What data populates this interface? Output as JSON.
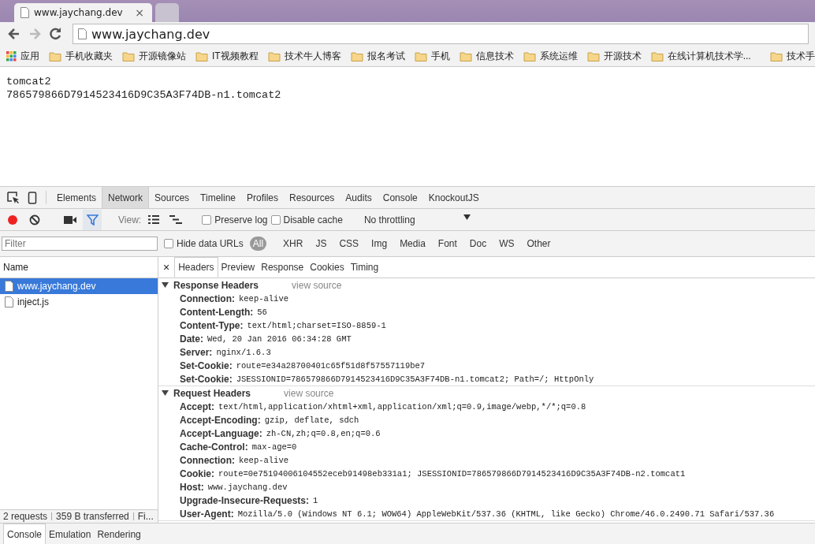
{
  "browser": {
    "tabs": [
      {
        "title": "www.jaychang.dev",
        "close": "×",
        "selected": true
      },
      {
        "selected": false
      }
    ],
    "address": "www.jaychang.dev",
    "bookmarks": [
      {
        "label": "应用",
        "kind": "apps"
      },
      {
        "label": "手机收藏夹",
        "kind": "folder"
      },
      {
        "label": "开源镜像站",
        "kind": "folder"
      },
      {
        "label": "IT视频教程",
        "kind": "folder"
      },
      {
        "label": "技术牛人博客",
        "kind": "folder"
      },
      {
        "label": "报名考试",
        "kind": "folder"
      },
      {
        "label": "手机",
        "kind": "folder"
      },
      {
        "label": "信息技术",
        "kind": "folder"
      },
      {
        "label": "系统运维",
        "kind": "folder"
      },
      {
        "label": "开源技术",
        "kind": "folder"
      },
      {
        "label": "在线计算机技术学...",
        "kind": "folder"
      },
      {
        "label": "技术手",
        "kind": "folder"
      }
    ]
  },
  "page": {
    "lines": [
      "tomcat2",
      "786579866D7914523416D9C35A3F74DB-n1.tomcat2"
    ]
  },
  "devtools": {
    "tabs": [
      {
        "label": "Elements",
        "selected": false
      },
      {
        "label": "Network",
        "selected": true
      },
      {
        "label": "Sources",
        "selected": false
      },
      {
        "label": "Timeline",
        "selected": false
      },
      {
        "label": "Profiles",
        "selected": false
      },
      {
        "label": "Resources",
        "selected": false
      },
      {
        "label": "Audits",
        "selected": false
      },
      {
        "label": "Console",
        "selected": false
      },
      {
        "label": "KnockoutJS",
        "selected": false
      }
    ],
    "recording": true,
    "filter_on": true,
    "view_label": "View:",
    "options": [
      {
        "label": "Preserve log",
        "checked": false
      },
      {
        "label": "Disable cache",
        "checked": false
      }
    ],
    "throttling": "No throttling",
    "filter_placeholder": "Filter",
    "hide_data_urls": {
      "label": "Hide data URLs",
      "checked": false
    },
    "types": [
      {
        "label": "All",
        "selected": true
      },
      {
        "label": "XHR",
        "selected": false
      },
      {
        "label": "JS",
        "selected": false
      },
      {
        "label": "CSS",
        "selected": false
      },
      {
        "label": "Img",
        "selected": false
      },
      {
        "label": "Media",
        "selected": false
      },
      {
        "label": "Font",
        "selected": false
      },
      {
        "label": "Doc",
        "selected": false
      },
      {
        "label": "WS",
        "selected": false
      },
      {
        "label": "Other",
        "selected": false
      }
    ],
    "name_header": "Name",
    "requests": [
      {
        "name": "www.jaychang.dev",
        "selected": true
      },
      {
        "name": "inject.js",
        "selected": false
      }
    ],
    "status": [
      "2 requests",
      "359 B transferred",
      "Fi..."
    ],
    "detail_close": "×",
    "detail_tabs": [
      {
        "label": "Headers",
        "selected": true
      },
      {
        "label": "Preview",
        "selected": false
      },
      {
        "label": "Response",
        "selected": false
      },
      {
        "label": "Cookies",
        "selected": false
      },
      {
        "label": "Timing",
        "selected": false
      }
    ],
    "sections": [
      {
        "title": "Response Headers",
        "expanded": true,
        "link": "view source",
        "headers": [
          {
            "name": "Connection:",
            "value": "keep-alive"
          },
          {
            "name": "Content-Length:",
            "value": "56"
          },
          {
            "name": "Content-Type:",
            "value": "text/html;charset=ISO-8859-1"
          },
          {
            "name": "Date:",
            "value": "Wed, 20 Jan 2016 06:34:28 GMT"
          },
          {
            "name": "Server:",
            "value": "nginx/1.6.3"
          },
          {
            "name": "Set-Cookie:",
            "value": "route=e34a28700401c65f51d8f57557119be7"
          },
          {
            "name": "Set-Cookie:",
            "value": "JSESSIONID=786579866D7914523416D9C35A3F74DB-n1.tomcat2; Path=/; HttpOnly"
          }
        ]
      },
      {
        "title": "Request Headers",
        "expanded": true,
        "link": "view source",
        "headers": [
          {
            "name": "Accept:",
            "value": "text/html,application/xhtml+xml,application/xml;q=0.9,image/webp,*/*;q=0.8"
          },
          {
            "name": "Accept-Encoding:",
            "value": "gzip, deflate, sdch"
          },
          {
            "name": "Accept-Language:",
            "value": "zh-CN,zh;q=0.8,en;q=0.6"
          },
          {
            "name": "Cache-Control:",
            "value": "max-age=0"
          },
          {
            "name": "Connection:",
            "value": "keep-alive"
          },
          {
            "name": "Cookie:",
            "value": "route=0e75194006104552eceb91498eb331a1; JSESSIONID=786579866D7914523416D9C35A3F74DB-n2.tomcat1"
          },
          {
            "name": "Host:",
            "value": "www.jaychang.dev"
          },
          {
            "name": "Upgrade-Insecure-Requests:",
            "value": "1"
          },
          {
            "name": "User-Agent:",
            "value": "Mozilla/5.0 (Windows NT 6.1; WOW64) AppleWebKit/537.36 (KHTML, like Gecko) Chrome/46.0.2490.71 Safari/537.36"
          }
        ]
      }
    ],
    "drawer_tabs": [
      {
        "label": "Console",
        "selected": true
      },
      {
        "label": "Emulation",
        "selected": false
      },
      {
        "label": "Rendering",
        "selected": false
      }
    ]
  }
}
